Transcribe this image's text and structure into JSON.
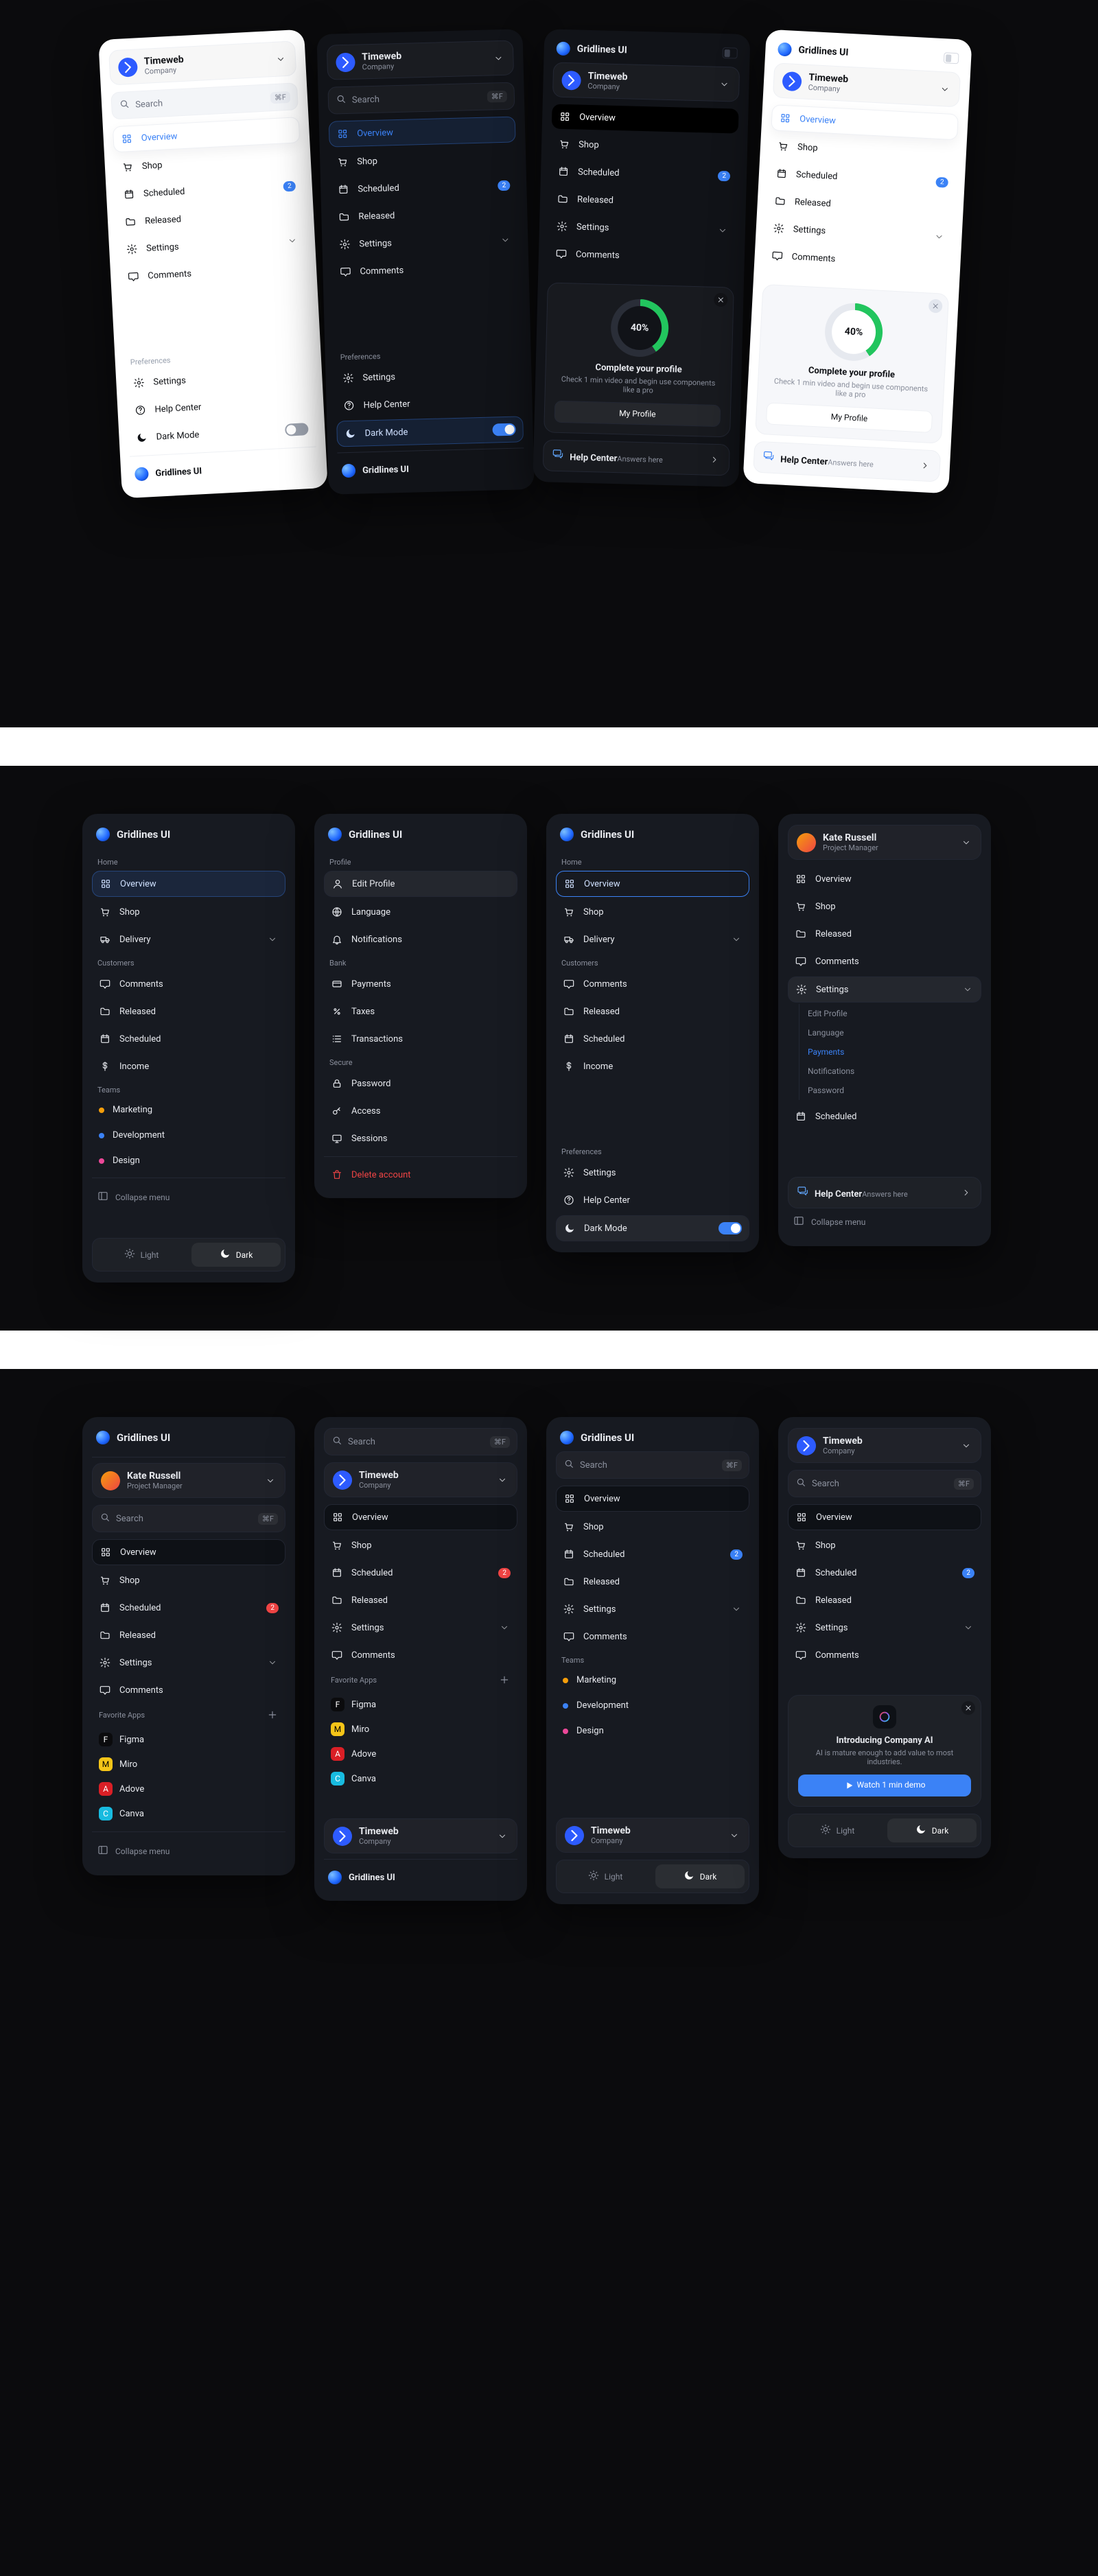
{
  "brand": {
    "name": "Gridlines UI"
  },
  "org": {
    "name": "Timeweb",
    "sub": "Company"
  },
  "search": {
    "placeholder": "Search",
    "kbd": "⌘F"
  },
  "nav": {
    "overview": "Overview",
    "shop": "Shop",
    "scheduled": "Scheduled",
    "released": "Released",
    "settings": "Settings",
    "comments": "Comments",
    "delivery": "Delivery",
    "income": "Income",
    "badge2": "2"
  },
  "sections": {
    "home": "Home",
    "customers": "Customers",
    "teams": "Teams",
    "preferences": "Preferences",
    "profile": "Profile",
    "bank": "Bank",
    "secure": "Secure",
    "favoriteApps": "Favorite Apps"
  },
  "teams": {
    "a": "Marketing",
    "b": "Development",
    "c": "Design"
  },
  "pref": {
    "settings": "Settings",
    "helpCenter": "Help Center",
    "darkMode": "Dark Mode"
  },
  "profile": {
    "edit": "Edit Profile",
    "language": "Language",
    "notifications": "Notifications",
    "payments": "Payments",
    "taxes": "Taxes",
    "transactions": "Transactions",
    "password": "Password",
    "access": "Access",
    "sessions": "Sessions",
    "delete": "Delete account"
  },
  "sub": {
    "edit": "Edit Profile",
    "language": "Language",
    "payments": "Payments",
    "notifications": "Notifications",
    "password": "Password"
  },
  "tile": {
    "pct": "40%",
    "title": "Complete your profile",
    "desc": "Check 1 min video and begin use components like a pro",
    "cta": "My Profile"
  },
  "ai": {
    "title": "Introducing Company AI",
    "desc": "AI is mature enough to add value to most industries.",
    "cta": "Watch 1 min demo"
  },
  "help": {
    "title": "Help Center",
    "sub": "Answers here"
  },
  "collapse": "Collapse menu",
  "theme": {
    "light": "Light",
    "dark": "Dark"
  },
  "user": {
    "name": "Kate Russell",
    "role": "Project Manager"
  },
  "apps": {
    "figma": "Figma",
    "miro": "Miro",
    "adobe": "Adove",
    "canva": "Canva"
  }
}
